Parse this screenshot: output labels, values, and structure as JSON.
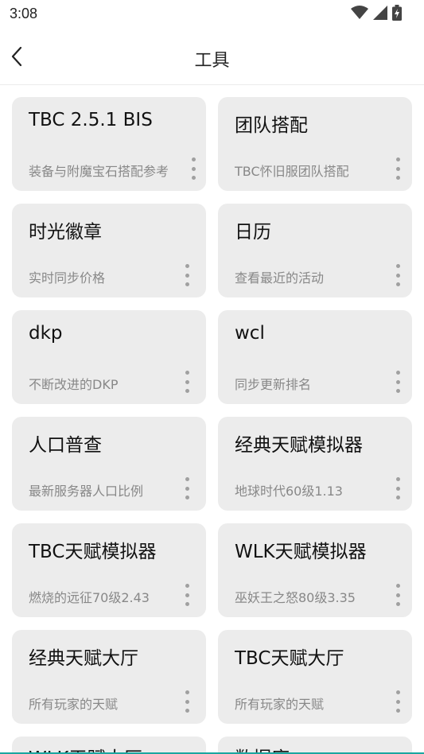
{
  "status": {
    "time": "3:08"
  },
  "header": {
    "title": "工具"
  },
  "cards": [
    {
      "title": "TBC 2.5.1 BIS",
      "subtitle": "装备与附魔宝石搭配参考"
    },
    {
      "title": "团队搭配",
      "subtitle": "TBC怀旧服团队搭配"
    },
    {
      "title": "时光徽章",
      "subtitle": "实时同步价格"
    },
    {
      "title": "日历",
      "subtitle": "查看最近的活动"
    },
    {
      "title": "dkp",
      "subtitle": "不断改进的DKP"
    },
    {
      "title": "wcl",
      "subtitle": "同步更新排名"
    },
    {
      "title": "人口普查",
      "subtitle": "最新服务器人口比例"
    },
    {
      "title": "经典天赋模拟器",
      "subtitle": "地球时代60级1.13"
    },
    {
      "title": "TBC天赋模拟器",
      "subtitle": "燃烧的远征70级2.43"
    },
    {
      "title": "WLK天赋模拟器",
      "subtitle": "巫妖王之怒80级3.35"
    },
    {
      "title": "经典天赋大厅",
      "subtitle": "所有玩家的天赋"
    },
    {
      "title": "TBC天赋大厅",
      "subtitle": "所有玩家的天赋"
    },
    {
      "title": "WLK天赋大厅",
      "subtitle": ""
    },
    {
      "title": "数据库",
      "subtitle": ""
    }
  ]
}
